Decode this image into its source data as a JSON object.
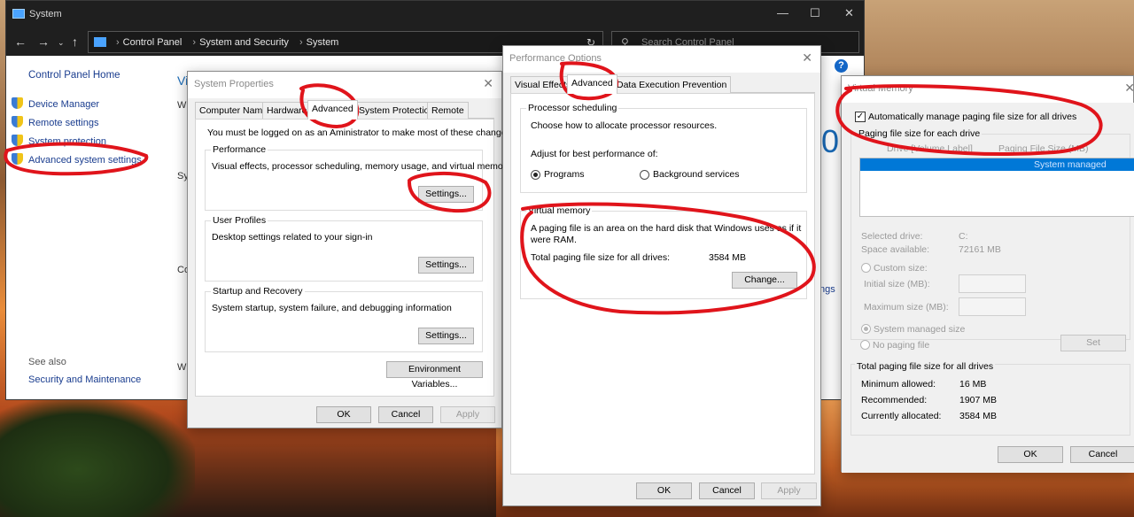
{
  "system_window": {
    "title": "System",
    "breadcrumbs": [
      "Control Panel",
      "System and Security",
      "System"
    ],
    "search_placeholder": "Search Control Panel",
    "sidebar": {
      "home": "Control Panel Home",
      "links": [
        "Device Manager",
        "Remote settings",
        "System protection",
        "Advanced system settings"
      ],
      "see_also": "See also",
      "see_also_links": [
        "Security and Maintenance"
      ]
    },
    "main_fragments": {
      "vi": "Vi",
      "wi1": "Wi",
      "sy": "Sy",
      "co": "Co",
      "wi2": "Wi",
      "zero": "0",
      "ngs": "ngs"
    }
  },
  "system_properties": {
    "title": "System Properties",
    "tabs": [
      "Computer Name",
      "Hardware",
      "Advanced",
      "System Protection",
      "Remote"
    ],
    "active_tab": "Advanced",
    "admin_note_left": "You must be logged on as an A",
    "admin_note_right": "ministrator to make most of these changes.",
    "performance": {
      "title": "Performance",
      "desc": "Visual effects, processor scheduling, memory usage, and virtual memory",
      "button": "Settings..."
    },
    "user_profiles": {
      "title": "User Profiles",
      "desc": "Desktop settings related to your sign-in",
      "button": "Settings..."
    },
    "startup_recovery": {
      "title": "Startup and Recovery",
      "desc": "System startup, system failure, and debugging information",
      "button": "Settings..."
    },
    "env_button": "Environment Variables...",
    "ok": "OK",
    "cancel": "Cancel",
    "apply": "Apply"
  },
  "performance_options": {
    "title": "Performance Options",
    "tabs": [
      "Visual Effects",
      "Advanced",
      "Data Execution Prevention"
    ],
    "active_tab": "Advanced",
    "processor_scheduling": {
      "title": "Processor scheduling",
      "desc": "Choose how to allocate processor resources.",
      "adjust_label": "Adjust for best performance of:",
      "options": [
        "Programs",
        "Background services"
      ],
      "selected": "Programs"
    },
    "virtual_memory": {
      "title": "Virtual memory",
      "desc_line1": "A paging file is an area on the hard disk that Windows uses as if it",
      "desc_line2": "were RAM.",
      "total_label": "Total paging file size for all drives:",
      "total_value": "3584 MB",
      "change_button": "Change..."
    },
    "ok": "OK",
    "cancel": "Cancel",
    "apply": "Apply"
  },
  "virtual_memory_dialog": {
    "title": "Virtual Memory",
    "auto_manage_label": "Automatically manage paging file size for all drives",
    "auto_manage_checked": true,
    "group_title": "Paging file size for each drive",
    "columns": [
      "Drive [Volume Label]",
      "Paging File Size (MB)"
    ],
    "drive_row": "System managed",
    "selected_drive_label": "Selected drive:",
    "selected_drive_value": "C:",
    "space_available_label": "Space available:",
    "space_available_value": "72161 MB",
    "custom_size": "Custom size:",
    "initial_size": "Initial size (MB):",
    "maximum_size": "Maximum size (MB):",
    "system_managed": "System managed size",
    "no_paging": "No paging file",
    "set_button": "Set",
    "totals_title": "Total paging file size for all drives",
    "minimum_label": "Minimum allowed:",
    "minimum_value": "16 MB",
    "recommended_label": "Recommended:",
    "recommended_value": "1907 MB",
    "allocated_label": "Currently allocated:",
    "allocated_value": "3584 MB",
    "ok": "OK",
    "cancel": "Cancel"
  },
  "colors": {
    "annotation_red": "#e0141b",
    "link_blue": "#1a3d8f",
    "selection_blue": "#0078d7"
  }
}
